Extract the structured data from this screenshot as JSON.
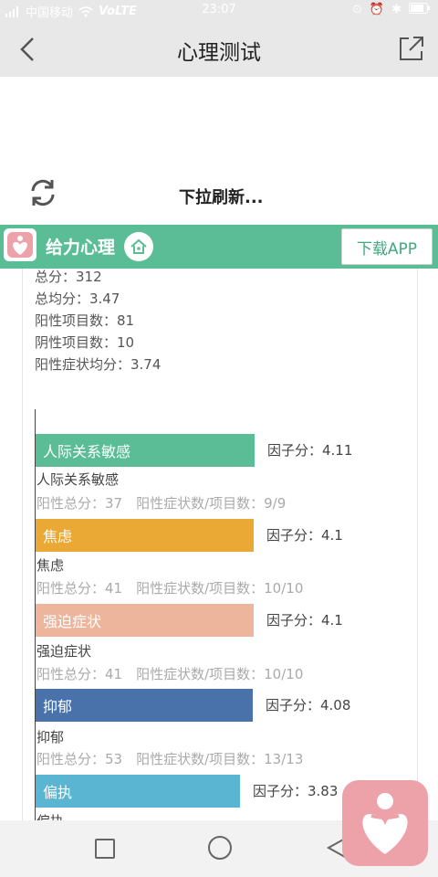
{
  "status_bar": {
    "carrier": "中国移动",
    "network": "VoLTE",
    "time": "23:07"
  },
  "header": {
    "title": "心理测试"
  },
  "refresh": {
    "text": "下拉刷新..."
  },
  "brand": {
    "name": "给力心理",
    "download_label": "下载APP",
    "color": "#5bbd96"
  },
  "summary": {
    "items": [
      "总分：312",
      "总均分：3.47",
      "阳性项目数：81",
      "阴性项目数：10",
      "阳性症状均分：3.74"
    ]
  },
  "factors": [
    {
      "name": "人际关系敏感",
      "bar_label": "人际关系敏感",
      "score_text": "因子分：4.11",
      "score": 4.11,
      "detail": "阳性总分：37　阳性症状数/项目数：9/9",
      "color": "#5bbd96"
    },
    {
      "name": "焦虑",
      "bar_label": "焦虑",
      "score_text": "因子分：4.1",
      "score": 4.1,
      "detail": "阳性总分：41　阳性症状数/项目数：10/10",
      "color": "#eaa935"
    },
    {
      "name": "强迫症状",
      "bar_label": "强迫症状",
      "score_text": "因子分：4.1",
      "score": 4.1,
      "detail": "阳性总分：41　阳性症状数/项目数：10/10",
      "color": "#edb59b"
    },
    {
      "name": "抑郁",
      "bar_label": "抑郁",
      "score_text": "因子分：4.08",
      "score": 4.08,
      "detail": "阳性总分：53　阳性症状数/项目数：13/13",
      "color": "#4a72aa"
    },
    {
      "name": "偏执",
      "bar_label": "偏执",
      "score_text": "因子分：3.83",
      "score": 3.83,
      "detail": "",
      "color": "#5ab5d3"
    }
  ]
}
